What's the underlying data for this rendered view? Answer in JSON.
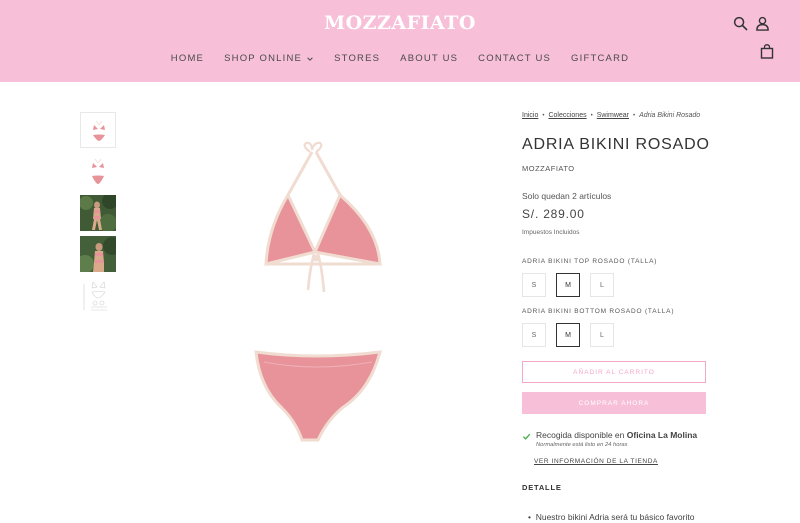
{
  "header": {
    "logo": "MOZZAFIATO",
    "nav": [
      {
        "label": "HOME"
      },
      {
        "label": "SHOP ONLINE"
      },
      {
        "label": "STORES"
      },
      {
        "label": "ABOUT US"
      },
      {
        "label": "CONTACT US"
      },
      {
        "label": "GIFTCARD"
      }
    ],
    "icons": [
      "search-icon",
      "user-icon",
      "bag-icon"
    ]
  },
  "breadcrumb": {
    "items": [
      "Inicio",
      "Colecciones",
      "Swimwear"
    ],
    "current": "Adria Bikini Rosado"
  },
  "product": {
    "title": "ADRIA BIKINI ROSADO",
    "vendor": "MOZZAFIATO",
    "stock": "Solo quedan 2 artículos",
    "price": "S/. 289.00",
    "tax_note": "Impuestos Incluidos",
    "option_top_label": "ADRIA BIKINI TOP ROSADO (TALLA)",
    "option_bottom_label": "ADRIA BIKINI BOTTOM ROSADO (TALLA)",
    "sizes": [
      "S",
      "M",
      "L"
    ],
    "selected_top": "M",
    "selected_bottom": "M",
    "add_to_cart": "AÑADIR AL CARRITO",
    "buy_now": "COMPRAR AHORA",
    "pickup_prefix": "Recogida disponible en",
    "pickup_location": "Oficina La Molina",
    "pickup_note": "Normalmente está listo en 24 horas",
    "store_link": "VER INFORMACIÓN DE LA TIENDA",
    "detail_heading": "DETALLE",
    "detail_bullet": "Nuestro bikini Adria será tu básico favorito"
  },
  "colors": {
    "brand_pink": "#f7c0d8",
    "bikini_pink": "#e8929a",
    "trim": "#f1dcd2"
  }
}
